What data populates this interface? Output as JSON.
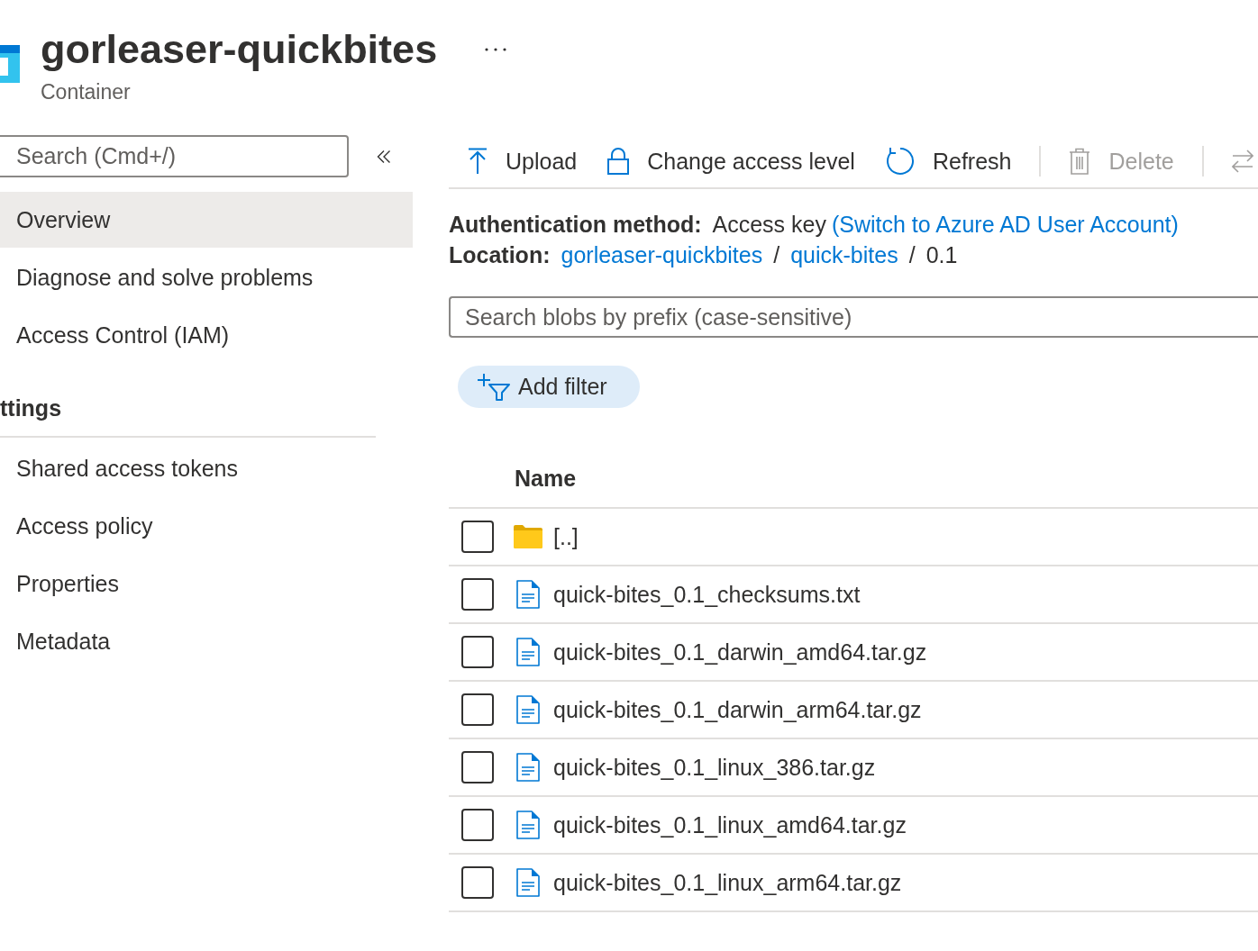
{
  "header": {
    "title": "gorleaser-quickbites",
    "subtitle": "Container"
  },
  "sidebar": {
    "search": {
      "placeholder": "Search (Cmd+/)"
    },
    "groups": [
      {
        "items": [
          {
            "label": "Overview",
            "selected": true
          },
          {
            "label": "Diagnose and solve problems",
            "selected": false
          },
          {
            "label": "Access Control (IAM)",
            "selected": false
          }
        ]
      },
      {
        "heading": "ttings",
        "items": [
          {
            "label": "Shared access tokens",
            "selected": false
          },
          {
            "label": "Access policy",
            "selected": false
          },
          {
            "label": "Properties",
            "selected": false
          },
          {
            "label": "Metadata",
            "selected": false
          }
        ]
      }
    ]
  },
  "toolbar": {
    "groups": [
      {
        "buttons": [
          {
            "kind": "upload",
            "label": "Upload",
            "disabled": false
          },
          {
            "kind": "access",
            "label": "Change access level",
            "disabled": false
          },
          {
            "kind": "refresh",
            "label": "Refresh",
            "disabled": false
          }
        ]
      },
      {
        "buttons": [
          {
            "kind": "delete",
            "label": "Delete",
            "disabled": true
          }
        ]
      },
      {
        "buttons": [
          {
            "kind": "switch",
            "disabled": true
          }
        ]
      }
    ]
  },
  "info": {
    "auth_label": "Authentication method:",
    "auth_value": "Access key",
    "auth_link": "(Switch to Azure AD User Account)",
    "location_label": "Location:",
    "location": [
      {
        "kind": "link",
        "text": "gorleaser-quickbites"
      },
      {
        "kind": "separator",
        "text": "/"
      },
      {
        "kind": "link",
        "text": "quick-bites"
      },
      {
        "kind": "separator",
        "text": "/"
      },
      {
        "kind": "text",
        "text": "0.1"
      }
    ]
  },
  "blob_search": {
    "placeholder": "Search blobs by prefix (case-sensitive)"
  },
  "filter_button": {
    "label": "Add filter"
  },
  "table": {
    "columns": [
      "Name"
    ],
    "rows": [
      {
        "kind": "folder",
        "name": "[..]",
        "checked": false
      },
      {
        "kind": "file",
        "name": "quick-bites_0.1_checksums.txt",
        "checked": false
      },
      {
        "kind": "file",
        "name": "quick-bites_0.1_darwin_amd64.tar.gz",
        "checked": false
      },
      {
        "kind": "file",
        "name": "quick-bites_0.1_darwin_arm64.tar.gz",
        "checked": false
      },
      {
        "kind": "file",
        "name": "quick-bites_0.1_linux_386.tar.gz",
        "checked": false
      },
      {
        "kind": "file",
        "name": "quick-bites_0.1_linux_amd64.tar.gz",
        "checked": false
      },
      {
        "kind": "file",
        "name": "quick-bites_0.1_linux_arm64.tar.gz",
        "checked": false
      }
    ]
  }
}
